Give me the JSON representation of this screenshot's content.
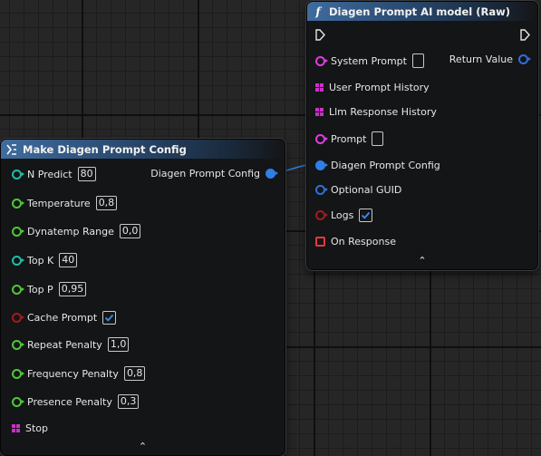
{
  "node_make_config": {
    "title": "Make Diagen Prompt Config",
    "output_label": "Diagen Prompt Config",
    "inputs": [
      {
        "label": "N Predict",
        "value": "80",
        "type": "int"
      },
      {
        "label": "Temperature",
        "value": "0,8",
        "type": "float"
      },
      {
        "label": "Dynatemp Range",
        "value": "0,0",
        "type": "float"
      },
      {
        "label": "Top K",
        "value": "40",
        "type": "int"
      },
      {
        "label": "Top P",
        "value": "0,95",
        "type": "float"
      },
      {
        "label": "Cache Prompt",
        "value": "checked",
        "type": "bool"
      },
      {
        "label": "Repeat Penalty",
        "value": "1,0",
        "type": "float"
      },
      {
        "label": "Frequency Penalty",
        "value": "0,8",
        "type": "float"
      },
      {
        "label": "Presence Penalty",
        "value": "0,3",
        "type": "float"
      },
      {
        "label": "Stop",
        "type": "string-array"
      }
    ],
    "collapse_glyph": "⌃"
  },
  "node_ai_model": {
    "title": "Diagen Prompt AI model (Raw)",
    "function_glyph": "f",
    "output_label": "Return Value",
    "inputs": [
      {
        "label": "System Prompt",
        "type": "string"
      },
      {
        "label": "User Prompt History",
        "type": "string-array"
      },
      {
        "label": "Llm Response History",
        "type": "string-array"
      },
      {
        "label": "Prompt",
        "type": "string"
      },
      {
        "label": "Diagen Prompt Config",
        "type": "struct-connected"
      },
      {
        "label": "Optional GUID",
        "type": "guid"
      },
      {
        "label": "Logs",
        "value": "checked",
        "type": "bool"
      },
      {
        "label": "On Response",
        "type": "delegate"
      }
    ],
    "collapse_glyph": "⌃"
  },
  "colors": {
    "header_accent": "#3f6c9e",
    "struct_pin": "#2f7fe5",
    "int_pin": "#1fbfa6",
    "float_pin": "#4fc83a",
    "bool_pin": "#a11c1c",
    "string_pin": "#e03ce0",
    "delegate_pin": "#e8383d",
    "wire": "#2f7fe5"
  }
}
